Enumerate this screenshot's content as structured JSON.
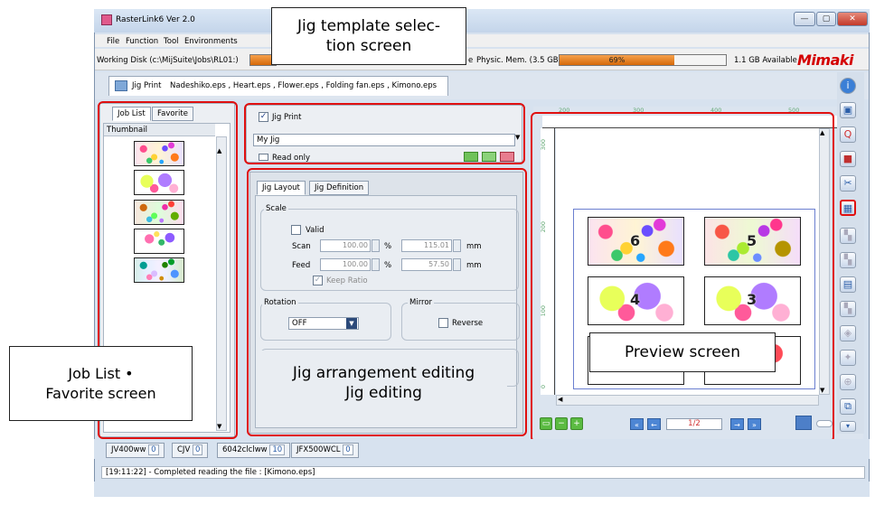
{
  "window": {
    "title": "RasterLink6 Ver 2.0",
    "minimize": "—",
    "maximize": "▢",
    "close": "✕"
  },
  "menu": [
    "File",
    "Function",
    "Tool",
    "Environments"
  ],
  "disk": {
    "label": "Working Disk (c:\\MijSuite\\Jobs\\RL01:)",
    "mem_prefix": "e",
    "mem_label": "Physic. Mem. (3.5 GB)",
    "mem_percent": "69%",
    "mem_fill": 0.69,
    "available": "1.1 GB Available",
    "logo": "Mimaki"
  },
  "job_tab": {
    "label": "Jig Print",
    "files": "Nadeshiko.eps , Heart.eps , Flower.eps , Folding fan.eps , Kimono.eps"
  },
  "left_panel": {
    "tabs": [
      "Job List",
      "Favorite"
    ],
    "column": "Thumbnail"
  },
  "jig_select": {
    "checkbox_label": "Jig Print",
    "checked": true,
    "template": "My Jig",
    "readonly_label": "Read only"
  },
  "jig_edit": {
    "tabs": [
      "Jig Layout",
      "Jig Definition"
    ],
    "scale": {
      "group": "Scale",
      "valid": "Valid",
      "scan_label": "Scan",
      "scan_pct": "100.00",
      "scan_mm": "115.01",
      "feed_label": "Feed",
      "feed_pct": "100.00",
      "feed_mm": "57.50",
      "pct": "%",
      "mm": "mm",
      "keep_ratio": "Keep Ratio"
    },
    "rotation": {
      "group": "Rotation",
      "value": "OFF"
    },
    "mirror": {
      "group": "Mirror",
      "reverse": "Reverse"
    }
  },
  "preview": {
    "ruler_top": [
      "200",
      "300",
      "400",
      "500"
    ],
    "ruler_left": [
      "300",
      "200",
      "100",
      "0"
    ],
    "page": "1/2",
    "numbers": [
      "6",
      "5",
      "4",
      "3"
    ]
  },
  "callouts": {
    "jig_template": "Jig template selec-\ntion screen",
    "job_list": "Job List •\nFavorite screen",
    "jig_arrangement": "Jig arrangement editing\nJig editing",
    "preview": "Preview screen"
  },
  "printers": [
    {
      "name": "JV400ww",
      "count": "0"
    },
    {
      "name": "CJV",
      "count": "0"
    },
    {
      "name": "6042clclww",
      "count": "10"
    },
    {
      "name": "JFX500WCL",
      "count": "0"
    }
  ],
  "log": "[19:11:22] - Completed reading the file : [Kimono.eps]"
}
